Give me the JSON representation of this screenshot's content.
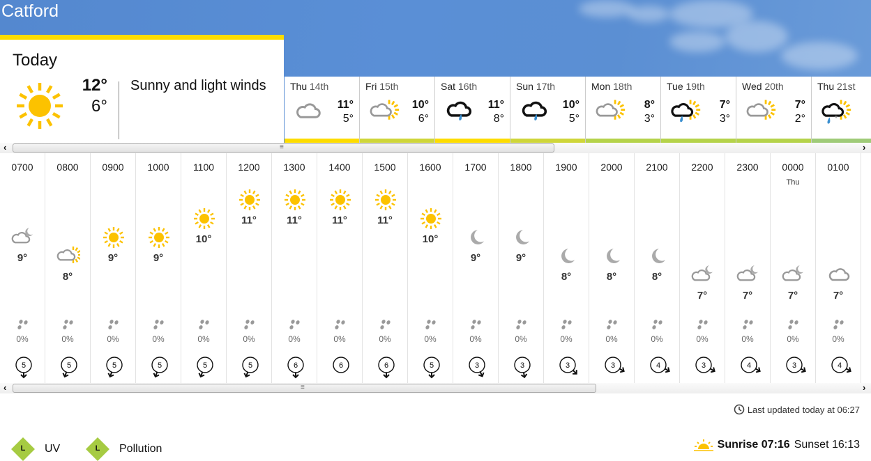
{
  "location": "Catford",
  "today": {
    "label": "Today",
    "icon": "sunny-icon",
    "high": "12°",
    "low": "6°",
    "summary": "Sunny and light winds"
  },
  "days": [
    {
      "name": "Thu",
      "date": "14th",
      "icon": "cloud-icon",
      "high": "11°",
      "low": "5°",
      "bar": "#fddc00"
    },
    {
      "name": "Fri",
      "date": "15th",
      "icon": "sun-cloud-icon",
      "high": "10°",
      "low": "6°",
      "bar": "#cfd63a"
    },
    {
      "name": "Sat",
      "date": "16th",
      "icon": "light-rain-icon",
      "high": "11°",
      "low": "8°",
      "bar": "#fddc00"
    },
    {
      "name": "Sun",
      "date": "17th",
      "icon": "light-rain-icon",
      "high": "10°",
      "low": "5°",
      "bar": "#cfd63a"
    },
    {
      "name": "Mon",
      "date": "18th",
      "icon": "sun-cloud-icon",
      "high": "8°",
      "low": "3°",
      "bar": "#b5d34a"
    },
    {
      "name": "Tue",
      "date": "19th",
      "icon": "sun-rain-icon",
      "high": "7°",
      "low": "3°",
      "bar": "#b5d34a"
    },
    {
      "name": "Wed",
      "date": "20th",
      "icon": "sun-cloud-icon",
      "high": "7°",
      "low": "2°",
      "bar": "#b5d34a"
    },
    {
      "name": "Thu",
      "date": "21st",
      "icon": "sun-sleet-icon",
      "high": "",
      "low": "",
      "bar": "#9fcb78"
    }
  ],
  "hours": [
    {
      "time": "0700",
      "day": "",
      "icon": "cloud-moon-icon",
      "temp": "9°",
      "rain": "0%",
      "wind": "5",
      "wind_dir": 0
    },
    {
      "time": "0800",
      "day": "",
      "icon": "sun-cloud-icon",
      "temp": "8°",
      "rain": "0%",
      "wind": "5",
      "wind_dir": 20
    },
    {
      "time": "0900",
      "day": "",
      "icon": "sunny-icon",
      "temp": "9°",
      "rain": "0%",
      "wind": "5",
      "wind_dir": 20
    },
    {
      "time": "1000",
      "day": "",
      "icon": "sunny-icon",
      "temp": "9°",
      "rain": "0%",
      "wind": "5",
      "wind_dir": 20
    },
    {
      "time": "1100",
      "day": "",
      "icon": "sunny-icon",
      "temp": "10°",
      "rain": "0%",
      "wind": "5",
      "wind_dir": 20
    },
    {
      "time": "1200",
      "day": "",
      "icon": "sunny-icon",
      "temp": "11°",
      "rain": "0%",
      "wind": "5",
      "wind_dir": 20
    },
    {
      "time": "1300",
      "day": "",
      "icon": "sunny-icon",
      "temp": "11°",
      "rain": "0%",
      "wind": "6",
      "wind_dir": 0
    },
    {
      "time": "1400",
      "day": "",
      "icon": "sunny-icon",
      "temp": "11°",
      "rain": "0%",
      "wind": "6",
      "wind_dir": null
    },
    {
      "time": "1500",
      "day": "",
      "icon": "sunny-icon",
      "temp": "11°",
      "rain": "0%",
      "wind": "6",
      "wind_dir": 0
    },
    {
      "time": "1600",
      "day": "",
      "icon": "sunny-icon",
      "temp": "10°",
      "rain": "0%",
      "wind": "5",
      "wind_dir": 0
    },
    {
      "time": "1700",
      "day": "",
      "icon": "moon-icon",
      "temp": "9°",
      "rain": "0%",
      "wind": "3",
      "wind_dir": -25
    },
    {
      "time": "1800",
      "day": "",
      "icon": "moon-icon",
      "temp": "9°",
      "rain": "0%",
      "wind": "3",
      "wind_dir": -10
    },
    {
      "time": "1900",
      "day": "",
      "icon": "moon-icon",
      "temp": "8°",
      "rain": "0%",
      "wind": "3",
      "wind_dir": -45
    },
    {
      "time": "2000",
      "day": "",
      "icon": "moon-icon",
      "temp": "8°",
      "rain": "0%",
      "wind": "3",
      "wind_dir": -60
    },
    {
      "time": "2100",
      "day": "",
      "icon": "moon-icon",
      "temp": "8°",
      "rain": "0%",
      "wind": "4",
      "wind_dir": -60
    },
    {
      "time": "2200",
      "day": "",
      "icon": "cloud-moon-icon",
      "temp": "7°",
      "rain": "0%",
      "wind": "3",
      "wind_dir": -60
    },
    {
      "time": "2300",
      "day": "",
      "icon": "cloud-moon-icon",
      "temp": "7°",
      "rain": "0%",
      "wind": "4",
      "wind_dir": -60
    },
    {
      "time": "0000",
      "day": "Thu",
      "icon": "cloud-moon-icon",
      "temp": "7°",
      "rain": "0%",
      "wind": "3",
      "wind_dir": -60
    },
    {
      "time": "0100",
      "day": "",
      "icon": "cloud-icon",
      "temp": "7°",
      "rain": "0%",
      "wind": "4",
      "wind_dir": -60
    },
    {
      "time": "",
      "day": "",
      "icon": "",
      "temp": "",
      "rain": "",
      "wind": "",
      "wind_dir": null
    }
  ],
  "footer": {
    "last_updated": "Last updated today at 06:27",
    "uv_level": "L",
    "uv_label": "UV",
    "pollution_level": "L",
    "pollution_label": "Pollution",
    "sunrise_label": "Sunrise 07:16",
    "sunset_label": "Sunset 16:13"
  },
  "colors": {
    "sun": "#fcc200",
    "cloud": "#999999",
    "rain_drop": "#3a8fd0",
    "indicator_low": "#a6cb42"
  }
}
